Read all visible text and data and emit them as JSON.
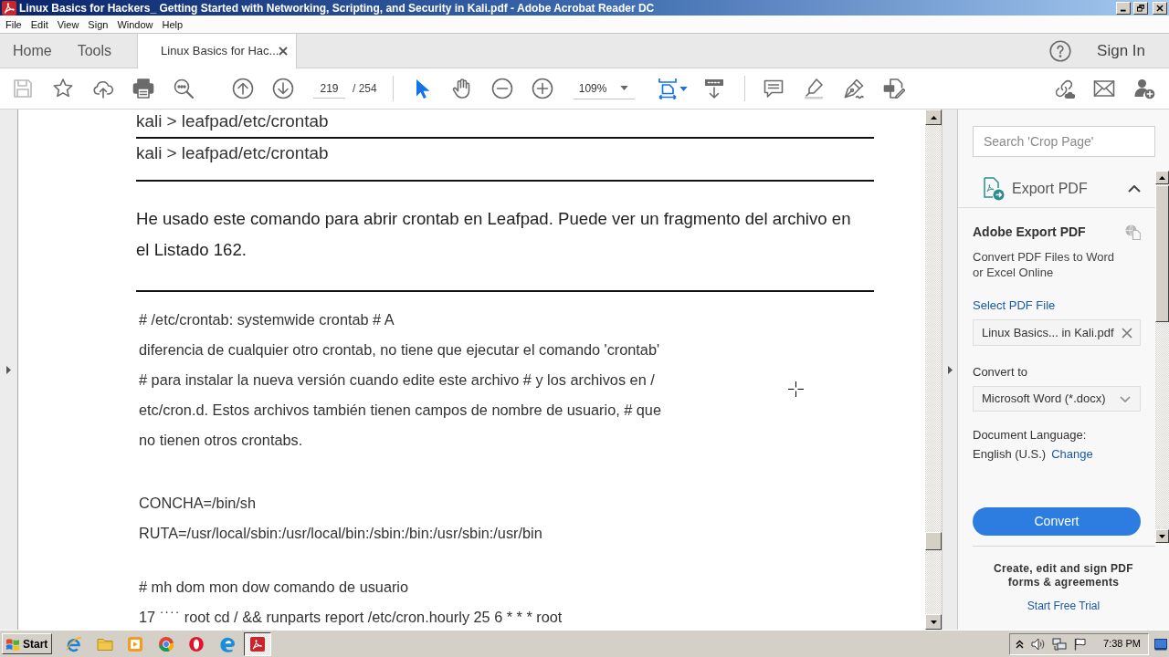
{
  "window": {
    "title": "Linux Basics for Hackers_ Getting Started with Networking, Scripting, and Security in Kali.pdf - Adobe Acrobat Reader DC"
  },
  "menu": [
    "File",
    "Edit",
    "View",
    "Sign",
    "Window",
    "Help"
  ],
  "tabs": [
    {
      "label": "Home",
      "selected": false,
      "closable": false
    },
    {
      "label": "Tools",
      "selected": false,
      "closable": false
    },
    {
      "label": "Linux Basics for Hac...",
      "selected": true,
      "closable": true
    }
  ],
  "account": {
    "sign_in": "Sign In"
  },
  "toolbar": {
    "page_number": "219",
    "page_total": "/ 254",
    "zoom": "109%",
    "tools": [
      {
        "kind": "select",
        "selected": true
      },
      {
        "kind": "hand",
        "selected": false
      }
    ]
  },
  "document": {
    "commands": [
      "kali > leafpad/etc/crontab",
      "kali > leafpad/etc/crontab"
    ],
    "paragraph": "He usado este comando para abrir crontab en Leafpad. Puede ver un fragmento del archivo en el Listado 162.",
    "listing": [
      [
        "# /etc/crontab: systemwide crontab # A",
        "diferencia de cualquier otro crontab, no tiene que ejecutar el comando 'crontab'",
        "# para instalar la nueva versión cuando edite este archivo # y los archivos en /",
        "etc/cron.d. Estos archivos también tienen campos de nombre de usuario, # que",
        "no tienen otros crontabs."
      ],
      [
        "CONCHA=/bin/sh",
        "RUTA=/usr/local/sbin:/usr/local/bin:/sbin:/bin:/usr/sbin:/usr/bin"
      ],
      [
        "# mh dom mon dow comando de usuario",
        "17 $^{····}$ root cd / && runparts report /etc/cron.hourly 25 6 * * * root"
      ]
    ]
  },
  "export_panel": {
    "search": {
      "placeholder": "Search 'Crop Page'"
    },
    "section": {
      "title": "Export PDF",
      "expanded": true
    },
    "heading": "Adobe Export PDF",
    "description": "Convert PDF Files to Word or Excel Online",
    "select_file": "Select PDF File",
    "file": {
      "value": "Linux Basics... in Kali.pdf"
    },
    "convert_to": {
      "label": "Convert to",
      "value": "Microsoft Word (*.docx)"
    },
    "language": {
      "label": "Document Language:",
      "value": "English (U.S.)",
      "change": "Change"
    },
    "convert_button": "Convert",
    "promo": {
      "text": "Create, edit and sign PDF forms & agreements",
      "link": "Start Free Trial"
    }
  },
  "taskbar": {
    "start": "Start",
    "apps": [
      {
        "kind": "ie",
        "selected": false
      },
      {
        "kind": "folder",
        "selected": false
      },
      {
        "kind": "media",
        "selected": false
      },
      {
        "kind": "chrome",
        "selected": false
      },
      {
        "kind": "opera",
        "selected": false
      },
      {
        "kind": "edge",
        "selected": false
      },
      {
        "kind": "acrobat",
        "selected": true
      }
    ],
    "clock": "7:38 PM"
  }
}
